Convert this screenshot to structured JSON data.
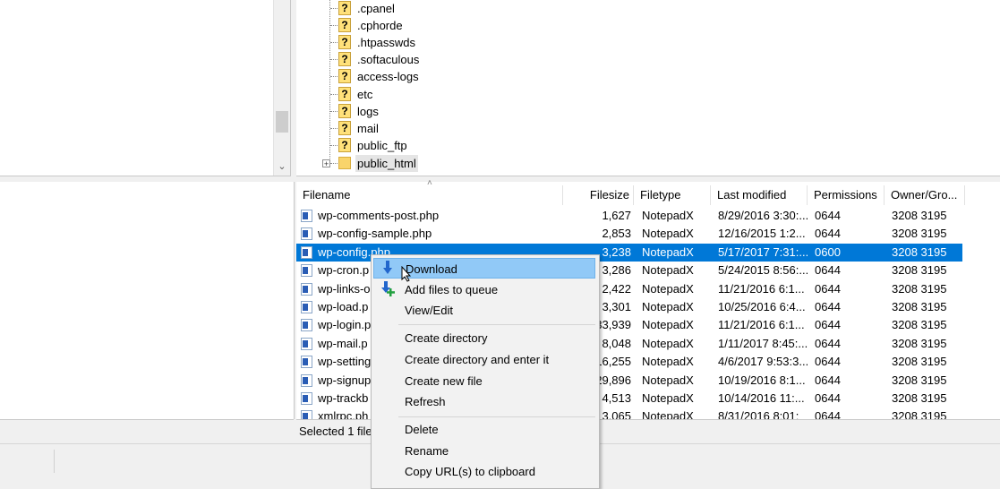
{
  "remote_tree": {
    "items": [
      ".cpanel",
      ".cphorde",
      ".htpasswds",
      ".softaculous",
      "access-logs",
      "etc",
      "logs",
      "mail",
      "public_ftp",
      "public_html"
    ]
  },
  "columns": [
    "Filename",
    "Filesize",
    "Filetype",
    "Last modified",
    "Permissions",
    "Owner/Gro..."
  ],
  "files": [
    {
      "name": "wp-comments-post.php",
      "size": "1,627",
      "type": "NotepadX",
      "modified": "8/29/2016 3:30:...",
      "perms": "0644",
      "owner": "3208 3195"
    },
    {
      "name": "wp-config-sample.php",
      "size": "2,853",
      "type": "NotepadX",
      "modified": "12/16/2015 1:2...",
      "perms": "0644",
      "owner": "3208 3195"
    },
    {
      "name": "wp-config.php",
      "size": "3,238",
      "type": "NotepadX",
      "modified": "5/17/2017 7:31:...",
      "perms": "0600",
      "owner": "3208 3195"
    },
    {
      "name": "wp-cron.p",
      "size": "3,286",
      "type": "NotepadX",
      "modified": "5/24/2015 8:56:...",
      "perms": "0644",
      "owner": "3208 3195"
    },
    {
      "name": "wp-links-o",
      "size": "2,422",
      "type": "NotepadX",
      "modified": "11/21/2016 6:1...",
      "perms": "0644",
      "owner": "3208 3195"
    },
    {
      "name": "wp-load.p",
      "size": "3,301",
      "type": "NotepadX",
      "modified": "10/25/2016 6:4...",
      "perms": "0644",
      "owner": "3208 3195"
    },
    {
      "name": "wp-login.p",
      "size": "33,939",
      "type": "NotepadX",
      "modified": "11/21/2016 6:1...",
      "perms": "0644",
      "owner": "3208 3195"
    },
    {
      "name": "wp-mail.p",
      "size": "8,048",
      "type": "NotepadX",
      "modified": "1/11/2017 8:45:...",
      "perms": "0644",
      "owner": "3208 3195"
    },
    {
      "name": "wp-setting",
      "size": "16,255",
      "type": "NotepadX",
      "modified": "4/6/2017 9:53:3...",
      "perms": "0644",
      "owner": "3208 3195"
    },
    {
      "name": "wp-signup",
      "size": "29,896",
      "type": "NotepadX",
      "modified": "10/19/2016 8:1...",
      "perms": "0644",
      "owner": "3208 3195"
    },
    {
      "name": "wp-trackb",
      "size": "4,513",
      "type": "NotepadX",
      "modified": "10/14/2016 11:...",
      "perms": "0644",
      "owner": "3208 3195"
    },
    {
      "name": "xmlrpc.ph",
      "size": "3,065",
      "type": "NotepadX",
      "modified": "8/31/2016 8:01:",
      "perms": "0644",
      "owner": "3208 3195"
    }
  ],
  "status": {
    "remote": "Selected 1 file."
  },
  "context_menu": {
    "download": "Download",
    "add_queue": "Add files to queue",
    "view_edit": "View/Edit",
    "create_dir": "Create directory",
    "create_dir_enter": "Create directory and enter it",
    "create_file": "Create new file",
    "refresh": "Refresh",
    "delete": "Delete",
    "rename": "Rename",
    "copy_url": "Copy URL(s) to clipboard"
  },
  "colors": {
    "selection": "#0078d7",
    "menu_hover": "#91c9f7",
    "folder": "#ffe17a"
  }
}
